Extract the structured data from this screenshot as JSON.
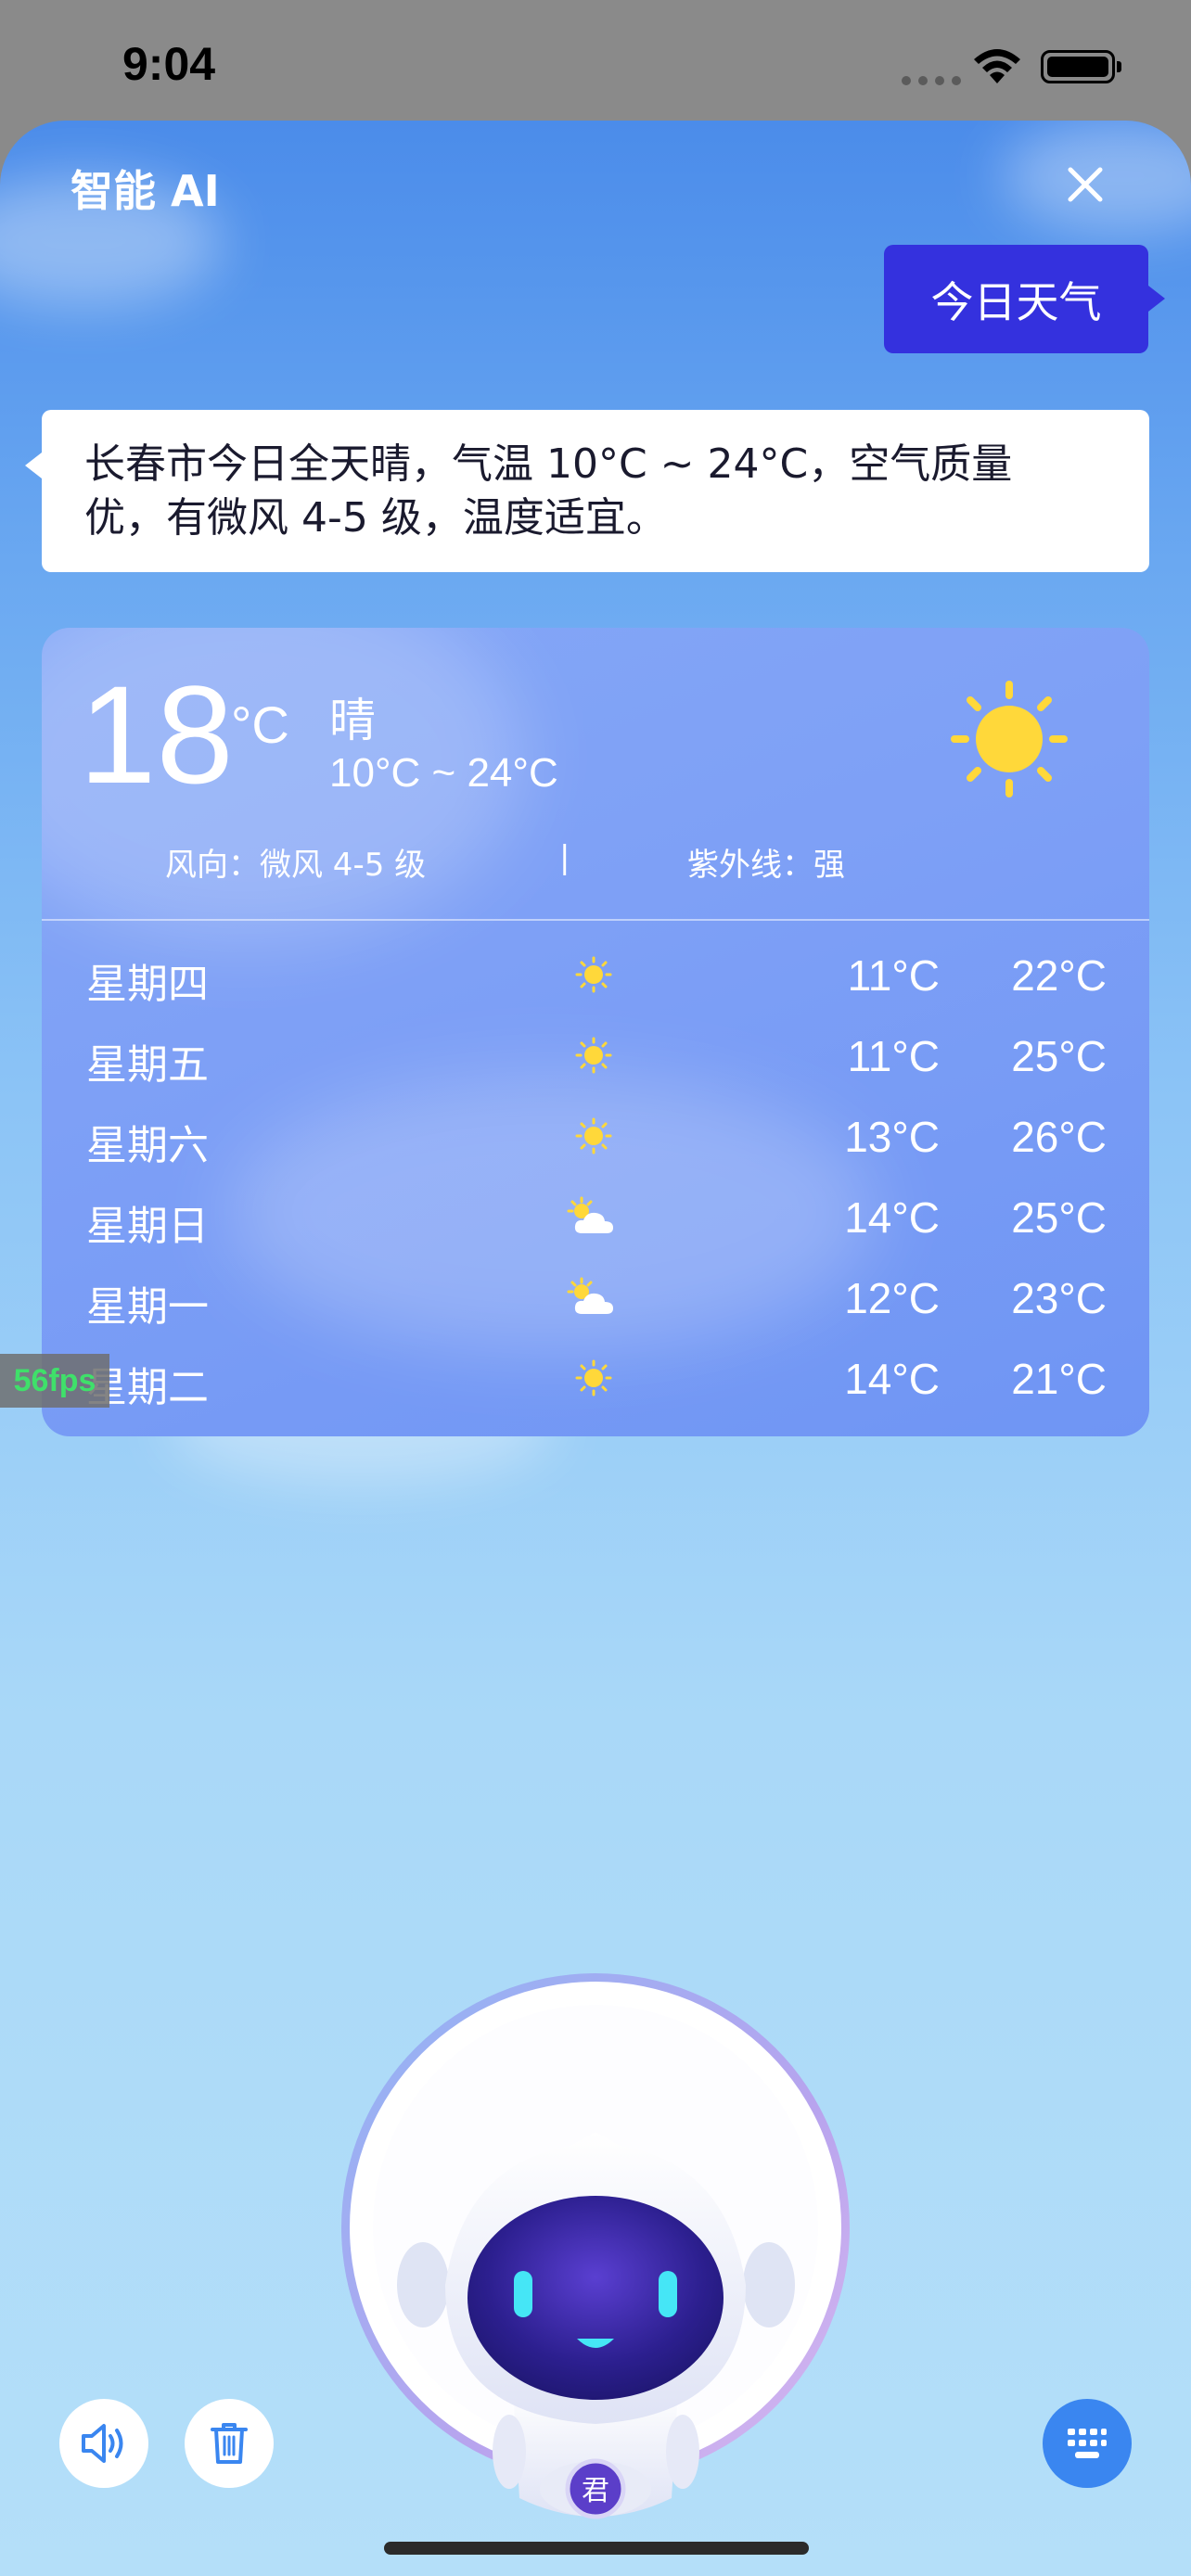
{
  "status_bar": {
    "time": "9:04"
  },
  "header": {
    "title": "智能 AI"
  },
  "chat": {
    "user_message": "今日天气",
    "ai_reply_line1": "长春市今日全天晴，气温 10°C ~ 24°C，空气质量",
    "ai_reply_line2": "优，有微风 4-5 级，温度适宜。"
  },
  "weather": {
    "current_temp": "18",
    "unit": "°C",
    "condition": "晴",
    "range": "10°C ~ 24°C",
    "wind": "风向：微风 4-5 级",
    "separator": "|",
    "uv": "紫外线：强",
    "forecast": [
      {
        "day": "星期四",
        "icon": "sun-icon",
        "low": "11°C",
        "high": "22°C"
      },
      {
        "day": "星期五",
        "icon": "sun-icon",
        "low": "11°C",
        "high": "25°C"
      },
      {
        "day": "星期六",
        "icon": "sun-icon",
        "low": "13°C",
        "high": "26°C"
      },
      {
        "day": "星期日",
        "icon": "partly-cloudy-icon",
        "low": "14°C",
        "high": "25°C"
      },
      {
        "day": "星期一",
        "icon": "partly-cloudy-icon",
        "low": "12°C",
        "high": "23°C"
      },
      {
        "day": "星期二",
        "icon": "sun-icon",
        "low": "14°C",
        "high": "21°C"
      }
    ]
  },
  "overlay": {
    "fps": "56fps"
  },
  "robot": {
    "badge": "君"
  },
  "colors": {
    "accent": "#3431de",
    "sun": "#ffd83a",
    "keyboard_button": "#3a86f0"
  }
}
